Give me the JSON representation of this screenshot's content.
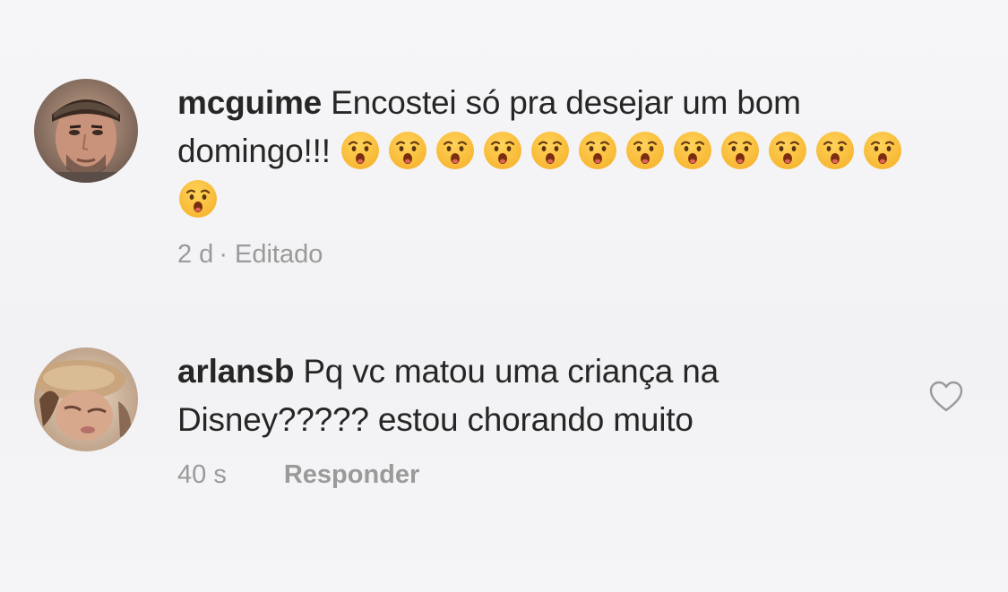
{
  "comments": [
    {
      "username": "mcguime",
      "text": "Encostei só pra desejar um bom domingo!!!",
      "emoji_name": "hushed-face-emoji",
      "emoji_count": 13,
      "time": "2 d",
      "separator": "·",
      "edited_label": "Editado"
    },
    {
      "username": "arlansb",
      "text": "Pq vc matou uma criança na Disney????? estou chorando muito",
      "time": "40 s",
      "reply_label": "Responder",
      "like_icon": "heart-outline-icon"
    }
  ],
  "colors": {
    "username": "#262626",
    "text": "#262626",
    "meta": "#9a9a9a",
    "emoji_face": "#f7b632"
  }
}
